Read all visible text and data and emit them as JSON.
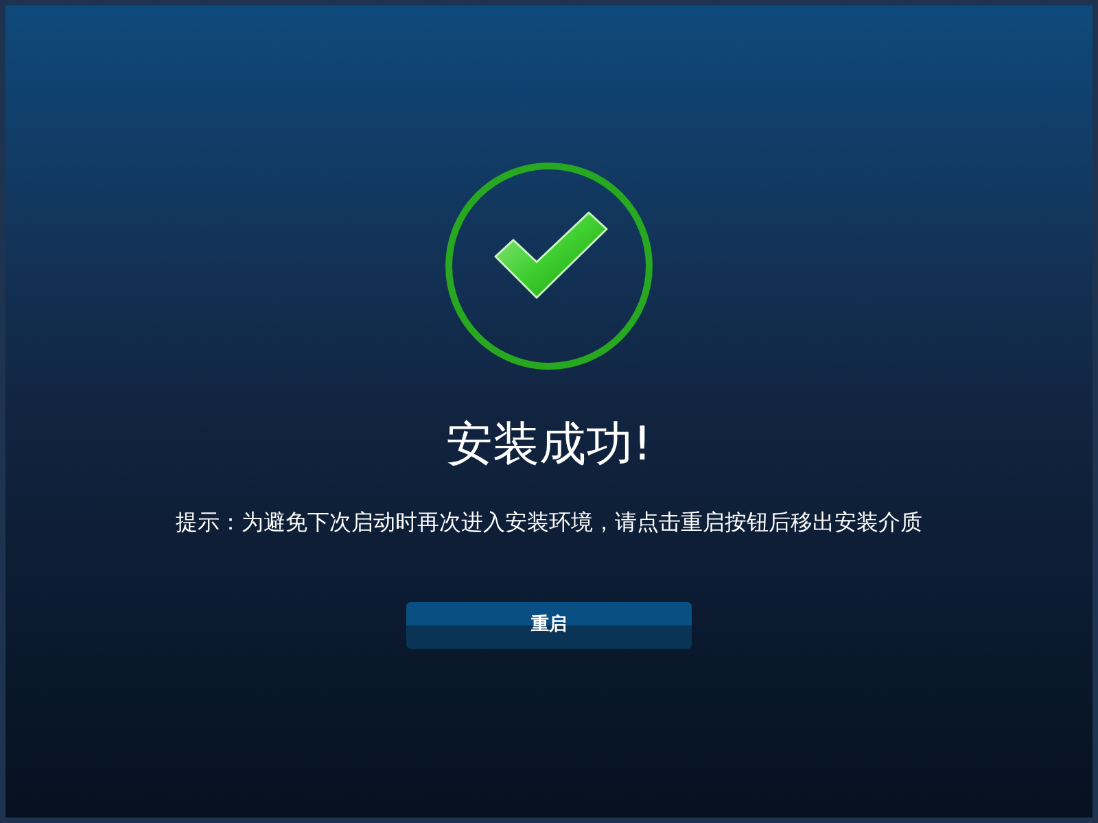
{
  "title": "安装成功!",
  "message": "提示：为避免下次启动时再次进入安装环境，请点击重启按钮后移出安装介质",
  "button": "重启"
}
